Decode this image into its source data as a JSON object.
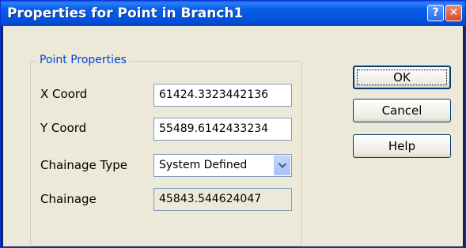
{
  "window": {
    "title": "Properties for Point in Branch1",
    "help_glyph": "?",
    "close_glyph": "✕"
  },
  "group": {
    "legend": "Point Properties",
    "fields": [
      {
        "label": "X Coord",
        "value": "61424.3323442136"
      },
      {
        "label": "Y Coord",
        "value": "55489.6142433234"
      },
      {
        "label": "Chainage Type",
        "value": "System Defined"
      },
      {
        "label": "Chainage",
        "value": "45843.544624047"
      }
    ]
  },
  "buttons": {
    "ok": "OK",
    "cancel": "Cancel",
    "help": "Help"
  },
  "icons": {
    "title_help": "help-icon",
    "title_close": "close-icon",
    "combo_arrow": "chevron-down-icon"
  }
}
